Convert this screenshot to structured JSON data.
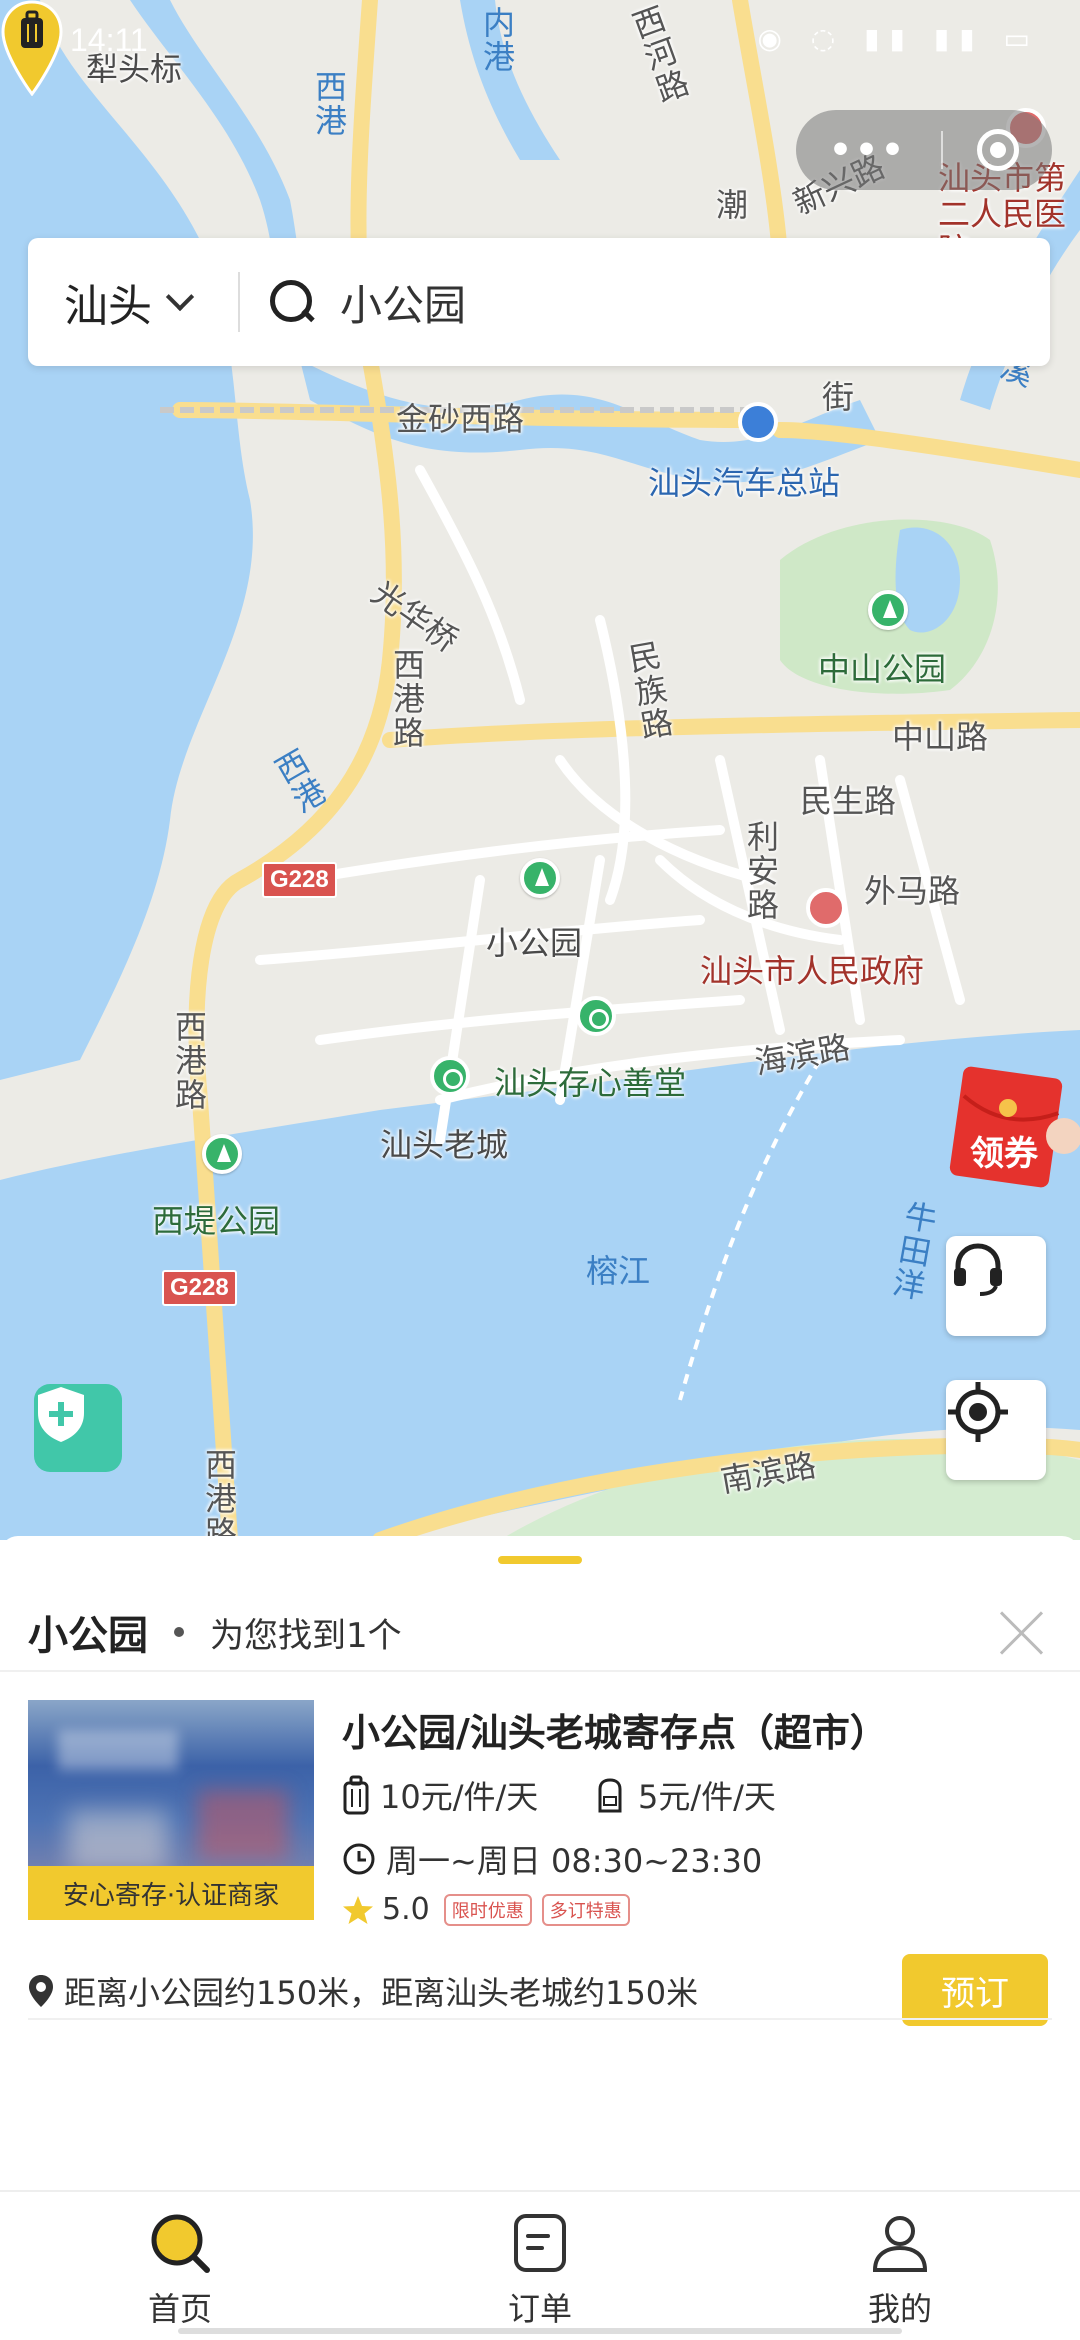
{
  "status_bar": {
    "time": "14:11"
  },
  "map": {
    "labels": {
      "lei_tou_biao": "犁头标",
      "xi_gang_top": "西港",
      "nei": "内港",
      "xi_road": "西河路",
      "xinxing_road": "新兴路",
      "chao_road": "潮",
      "hospital": "汕头市第二人民医院",
      "jinsha_xi_road": "金砂西路",
      "street": "街",
      "bus_station": "汕头汽车总站",
      "meixi": "梅溪",
      "guanghua_bridge": "光华桥",
      "xigang_road_1": "西港路",
      "minzu_road": "民族路",
      "zhongshan_park": "中山公园",
      "zhongshan_road": "中山路",
      "xigang_2": "西港",
      "minsheng_road": "民生路",
      "lian_road": "利安路",
      "waima_road": "外马路",
      "g228_1": "G228",
      "xiaogongyuan": "小公园",
      "gov": "汕头市人民政府",
      "xigang_road_2": "西港路",
      "cunxin_hall": "汕头存心善堂",
      "haibin_road": "海滨路",
      "old_town": "汕头老城",
      "xidi_park": "西堤公园",
      "g228_2": "G228",
      "rongjiang": "榕江",
      "niutianyang": "牛田洋",
      "nanbin_road": "南滨路",
      "xigang_road_3": "西港路"
    }
  },
  "search": {
    "city": "汕头",
    "query": "小公园"
  },
  "coupon_label": "领券",
  "result": {
    "keyword": "小公园",
    "summary": "为您找到1个"
  },
  "store": {
    "name": "小公园/汕头老城寄存点（超市）",
    "badge": "安心寄存·认证商家",
    "price_luggage": "10元/件/天",
    "price_bag": "5元/件/天",
    "hours": "周一~周日 08:30~23:30",
    "rating": "5.0",
    "tag_1": "限时优惠",
    "tag_2": "多订特惠",
    "distance": "距离小公园约150米，距离汕头老城约150米",
    "book_label": "预订"
  },
  "tabs": [
    {
      "label": "首页"
    },
    {
      "label": "订单"
    },
    {
      "label": "我的"
    }
  ],
  "colors": {
    "accent": "#F1C92E",
    "water": "#A9D3F5",
    "road": "#F9DE8F"
  }
}
